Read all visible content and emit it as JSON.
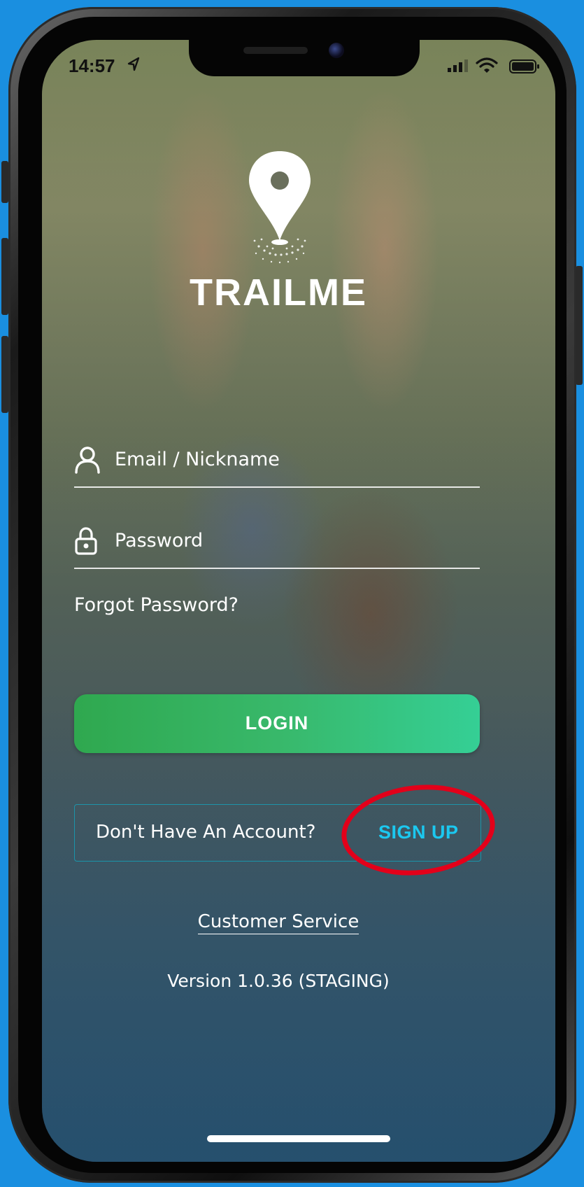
{
  "status_bar": {
    "time": "14:57"
  },
  "app": {
    "logo_text": "TRAILME"
  },
  "login_form": {
    "email_placeholder": "Email / Nickname",
    "password_placeholder": "Password",
    "forgot_password": "Forgot Password?",
    "login_label": "LOGIN"
  },
  "signup": {
    "question": "Don't Have An Account?",
    "signup_label": "SIGN UP"
  },
  "footer": {
    "customer_service": "Customer Service",
    "version": "Version 1.0.36 (STAGING)"
  },
  "colors": {
    "login_button": "#35b868",
    "signup_text": "#1bc8f0",
    "annotation_circle": "#e3001a",
    "background": "#1a8fe0"
  },
  "icons": {
    "location_arrow": "location-arrow-icon",
    "signal": "cellular-signal-icon",
    "wifi": "wifi-icon",
    "battery": "battery-icon",
    "logo_pin": "map-pin-icon",
    "user": "user-icon",
    "lock": "lock-icon"
  }
}
